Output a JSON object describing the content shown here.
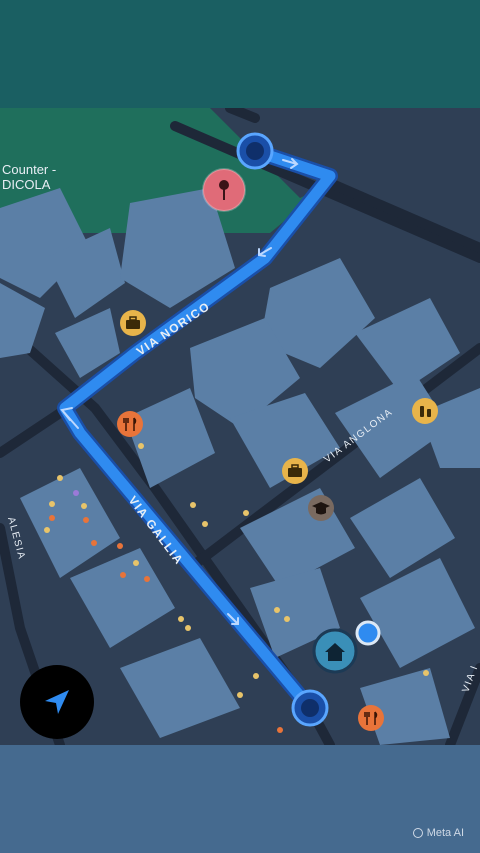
{
  "map": {
    "poi_label_line1": "Counter -",
    "poi_label_line2": "DICOLA",
    "streets": {
      "via_norico": "VIA NORICO",
      "via_gallia": "VIA GALLIA",
      "via_anglona": "VIA ANGLONA",
      "via_alesia": "ALESIA",
      "via_right_edge": "VIA I"
    },
    "route_color": "#2f8bf0",
    "park_color": "#1f6f5c"
  },
  "controls": {
    "navigate_icon": "navigation-arrow-icon"
  },
  "watermark": {
    "text": "Meta AI"
  }
}
